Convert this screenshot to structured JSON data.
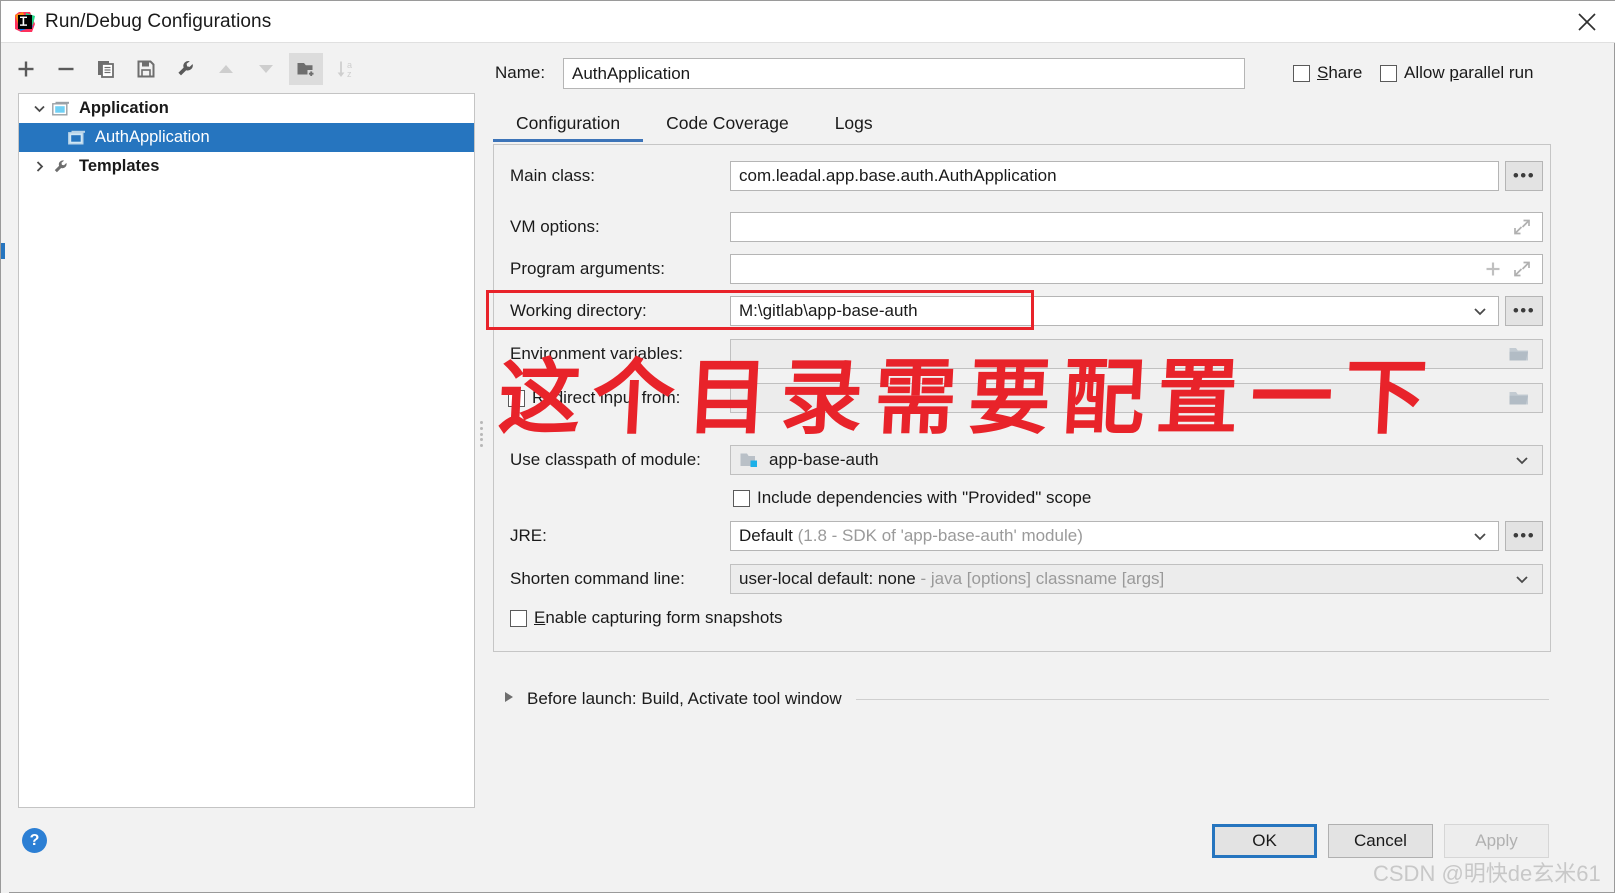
{
  "window": {
    "title": "Run/Debug Configurations",
    "app_icon": "intellij-idea-icon",
    "close_icon": "close-icon"
  },
  "toolbar": {
    "buttons": [
      {
        "name": "add-button",
        "icon": "plus-icon",
        "enabled": true,
        "active": false
      },
      {
        "name": "remove-button",
        "icon": "minus-icon",
        "enabled": true,
        "active": false
      },
      {
        "name": "copy-button",
        "icon": "copy-icon",
        "enabled": true,
        "active": false
      },
      {
        "name": "save-button",
        "icon": "save-icon",
        "enabled": true,
        "active": false
      },
      {
        "name": "edit-templates-button",
        "icon": "wrench-icon",
        "enabled": true,
        "active": false
      },
      {
        "name": "move-up-button",
        "icon": "arrow-up-icon",
        "enabled": false,
        "active": false
      },
      {
        "name": "move-down-button",
        "icon": "arrow-down-icon",
        "enabled": false,
        "active": false
      },
      {
        "name": "new-folder-button",
        "icon": "folder-add-icon",
        "enabled": true,
        "active": true
      },
      {
        "name": "sort-button",
        "icon": "sort-az-icon",
        "enabled": false,
        "active": false
      }
    ]
  },
  "tree": {
    "items": [
      {
        "label": "Application",
        "icon": "application-icon",
        "chevron": "chevron-down-icon",
        "selected": false,
        "indent": false
      },
      {
        "label": "AuthApplication",
        "icon": "application-icon",
        "chevron": "",
        "selected": true,
        "indent": true
      },
      {
        "label": "Templates",
        "icon": "wrench-icon",
        "chevron": "chevron-right-icon",
        "selected": false,
        "indent": false
      }
    ]
  },
  "header": {
    "name_label": "Name:",
    "name_value": "AuthApplication",
    "share_label": "Share",
    "share_mnemonic": "S",
    "share_checked": false,
    "parallel_label": "Allow parallel run",
    "parallel_label_pre": "Allow ",
    "parallel_mnemonic": "p",
    "parallel_label_post": "arallel run",
    "parallel_checked": false
  },
  "tabs": [
    {
      "label": "Configuration",
      "active": true
    },
    {
      "label": "Code Coverage",
      "active": false
    },
    {
      "label": "Logs",
      "active": false
    }
  ],
  "form": {
    "main_class": {
      "label": "Main class:",
      "value": "com.leadal.app.base.auth.AuthApplication",
      "browse_icon": "ellipsis-icon"
    },
    "vm_options": {
      "label": "VM options:",
      "value": "",
      "expand_icon": "expand-diagonal-icon"
    },
    "program_arguments": {
      "label": "Program arguments:",
      "value": "",
      "add_icon": "plus-icon",
      "expand_icon": "expand-diagonal-icon"
    },
    "working_directory": {
      "label": "Working directory:",
      "value": "M:\\gitlab\\app-base-auth",
      "chevron_icon": "chevron-down-icon",
      "browse_icon": "ellipsis-icon",
      "highlighted": true
    },
    "environment_variables": {
      "label": "Environment variables:",
      "value": "",
      "browse_icon": "folder-icon"
    },
    "redirect_input": {
      "label": "Redirect input from:",
      "checked": false,
      "value": "",
      "browse_icon": "folder-icon"
    },
    "classpath_module": {
      "label": "Use classpath of module:",
      "value": "app-base-auth",
      "module_icon": "module-folder-icon",
      "chevron_icon": "chevron-down-icon"
    },
    "include_provided": {
      "label": "Include dependencies with \"Provided\" scope",
      "checked": false
    },
    "jre": {
      "label": "JRE:",
      "value": "Default",
      "value_hint": "(1.8 - SDK of 'app-base-auth' module)",
      "chevron_icon": "chevron-down-icon",
      "browse_icon": "ellipsis-icon"
    },
    "shorten_command_line": {
      "label": "Shorten command line:",
      "value": "user-local default: none",
      "value_hint": "- java [options] classname [args]",
      "chevron_icon": "chevron-down-icon"
    },
    "form_snapshots": {
      "label": "Enable capturing form snapshots",
      "label_pre": "",
      "mnemonic": "E",
      "label_post": "nable capturing form snapshots",
      "checked": false
    }
  },
  "before_launch": {
    "expander_icon": "triangle-right-icon",
    "label": "Before launch: Build, Activate tool window"
  },
  "footer": {
    "help_label": "?",
    "ok_label": "OK",
    "cancel_label": "Cancel",
    "apply_label": "Apply",
    "apply_disabled": true
  },
  "annotations": {
    "red_box_target": "working-directory-row",
    "chinese_note": "这个目录需要配置一下",
    "watermark": "CSDN @明快de玄米61",
    "accent_blue": "#2675bf",
    "annotation_red": "#e8232a"
  }
}
